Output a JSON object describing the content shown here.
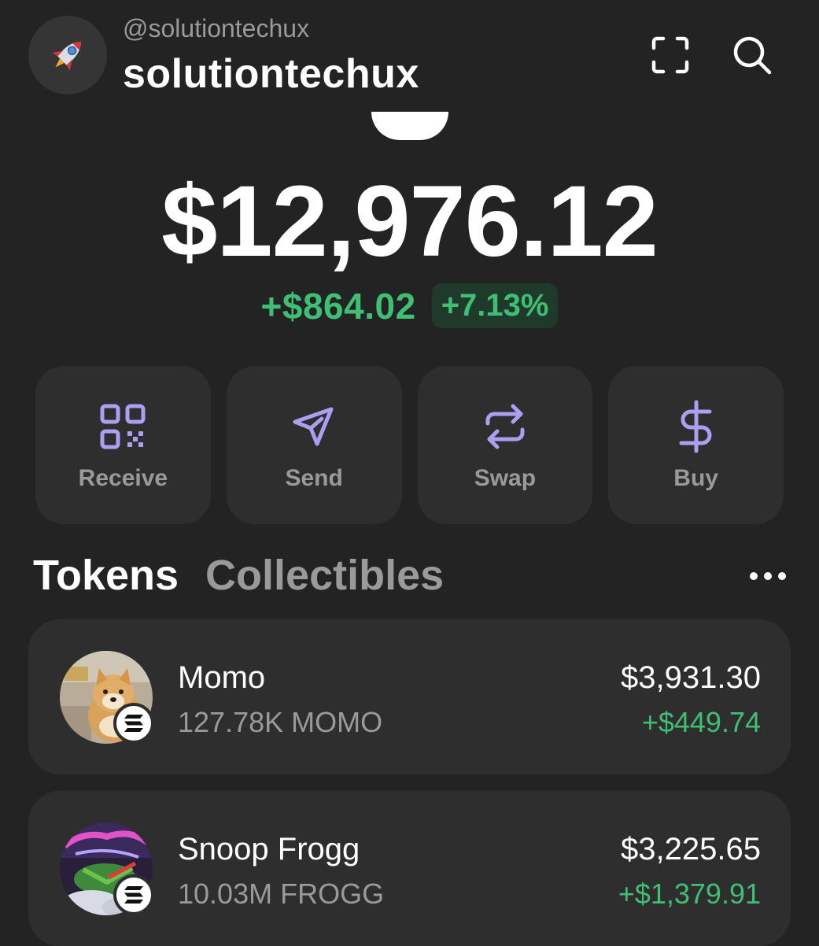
{
  "header": {
    "handle": "@solutiontechux",
    "username": "solutiontechux",
    "avatar_icon": "rocket-icon",
    "scan_icon": "scan-icon",
    "search_icon": "search-icon"
  },
  "balance": {
    "total": "$12,976.12",
    "change_amount": "+$864.02",
    "change_percent": "+7.13%"
  },
  "actions": [
    {
      "label": "Receive",
      "icon": "qr-code-icon"
    },
    {
      "label": "Send",
      "icon": "send-icon"
    },
    {
      "label": "Swap",
      "icon": "swap-icon"
    },
    {
      "label": "Buy",
      "icon": "dollar-icon"
    }
  ],
  "tabs": {
    "tokens": "Tokens",
    "collectibles": "Collectibles",
    "more_icon": "more-horizontal-icon"
  },
  "tokens": [
    {
      "name": "Momo",
      "quantity": "127.78K MOMO",
      "value": "$3,931.30",
      "change": "+$449.74",
      "chain_icon": "solana-icon"
    },
    {
      "name": "Snoop Frogg",
      "quantity": "10.03M FROGG",
      "value": "$3,225.65",
      "change": "+$1,379.91",
      "chain_icon": "solana-icon"
    }
  ],
  "colors": {
    "background": "#232323",
    "card": "#2e2e2e",
    "accent": "#ab9ff2",
    "positive": "#3fbf73",
    "muted_text": "#9a9a9a"
  }
}
